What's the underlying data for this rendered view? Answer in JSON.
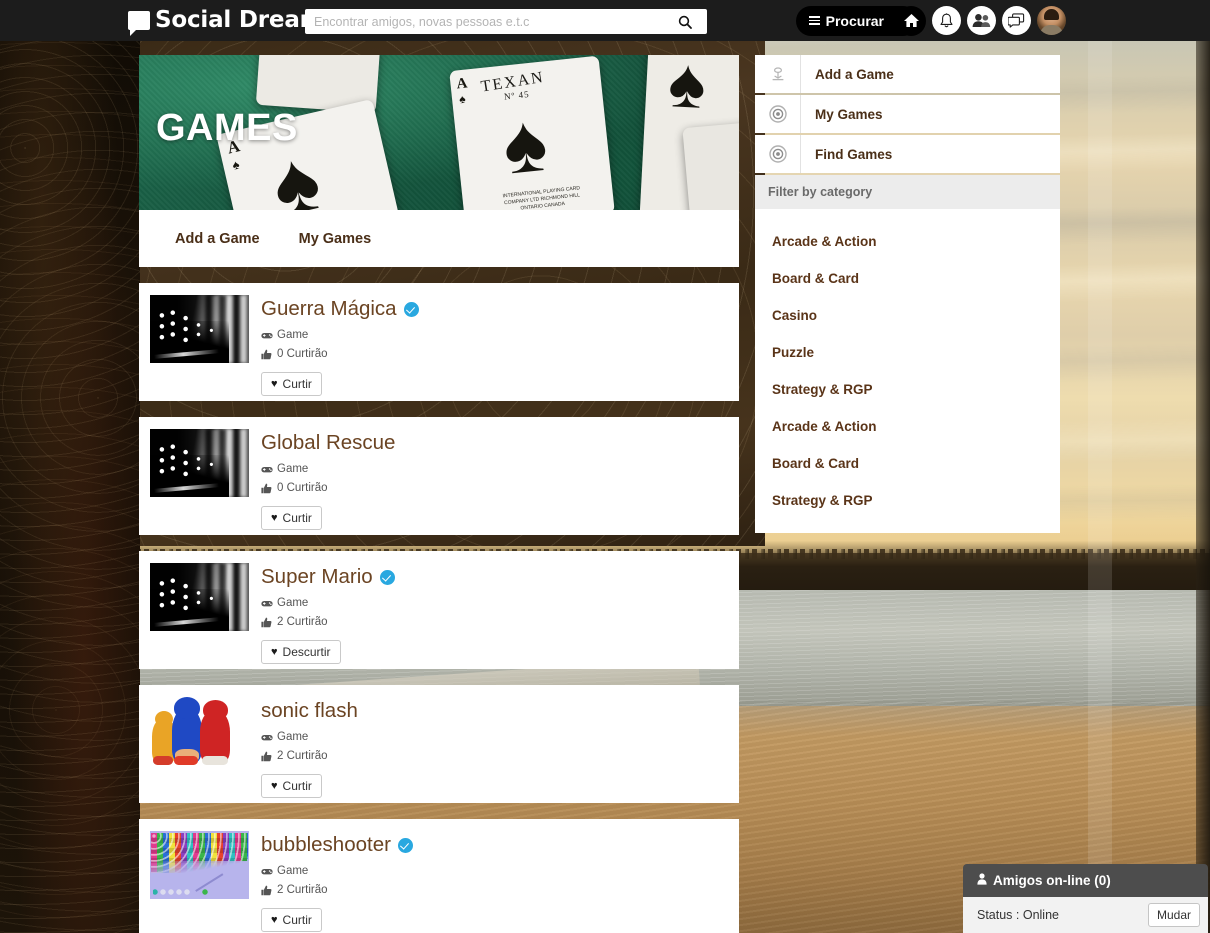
{
  "navbar": {
    "brand": "Social Dream",
    "brand_icon": "speech-bubble-icon",
    "search_placeholder": "Encontrar amigos, novas pessoas e.t.c",
    "search_value": "",
    "search_icon": "search-icon",
    "procurar_label": "Procurar",
    "icons": [
      {
        "name": "home-icon",
        "glyph": "⌂"
      },
      {
        "name": "bell-icon",
        "glyph": "♗"
      },
      {
        "name": "friends-icon",
        "glyph": "\u0000"
      },
      {
        "name": "messages-icon",
        "glyph": "\u0000"
      }
    ]
  },
  "cover": {
    "title": "GAMES",
    "photo_description": "ace-of-spades-playing-cards-on-green-felt",
    "tabs": [
      {
        "label": "Add a Game"
      },
      {
        "label": "My Games"
      }
    ]
  },
  "games": [
    {
      "title": "Guerra Mágica",
      "verified": true,
      "type_label": "Game",
      "likes_label": "0 Curtirão",
      "button_label": "Curtir",
      "thumb": "dominoes"
    },
    {
      "title": "Global Rescue",
      "verified": false,
      "type_label": "Game",
      "likes_label": "0 Curtirão",
      "button_label": "Curtir",
      "thumb": "dominoes"
    },
    {
      "title": "Super Mario",
      "verified": true,
      "type_label": "Game",
      "likes_label": "2 Curtirão",
      "button_label": "Descurtir",
      "thumb": "dominoes"
    },
    {
      "title": "sonic flash",
      "verified": false,
      "type_label": "Game",
      "likes_label": "2 Curtirão",
      "button_label": "Curtir",
      "thumb": "sonic"
    },
    {
      "title": "bubbleshooter",
      "verified": true,
      "type_label": "Game",
      "likes_label": "2 Curtirão",
      "button_label": "Curtir",
      "thumb": "bubble"
    }
  ],
  "sidebar": {
    "items": [
      {
        "label": "Add a Game",
        "icon": "add-game-icon"
      },
      {
        "label": "My Games",
        "icon": "target-icon"
      },
      {
        "label": "Find Games",
        "icon": "target-icon"
      }
    ],
    "filter_header": "Filter by category",
    "categories": [
      {
        "label": "Arcade & Action"
      },
      {
        "label": "Board & Card"
      },
      {
        "label": "Casino"
      },
      {
        "label": "Puzzle"
      },
      {
        "label": "Strategy & RGP"
      },
      {
        "label": "Arcade & Action"
      },
      {
        "label": "Board & Card"
      },
      {
        "label": "Strategy & RGP"
      }
    ]
  },
  "chat": {
    "header": "Amigos on-line (0)",
    "status": "Status : Online",
    "button_label": "Mudar"
  },
  "colors": {
    "navbar_bg": "#1c1c1c",
    "title_brown": "#6b4423",
    "sidebar_label": "#4a2f18",
    "verified_blue": "#29a8e0",
    "chat_header_bg": "#4d4d4d",
    "filter_header_bg": "#ececec"
  }
}
